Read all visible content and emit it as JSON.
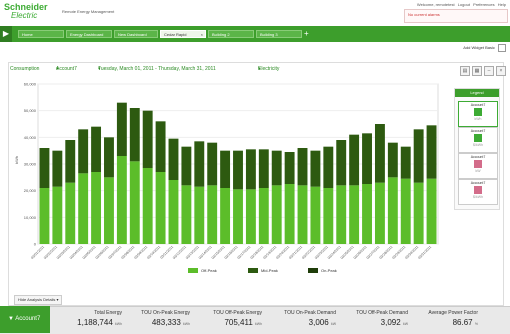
{
  "header": {
    "logo_line1": "Schneider",
    "logo_line2": "Electric",
    "app_name": "Remote Energy Management",
    "links": [
      "Welcome, remotetest",
      "Logout",
      "Preferences",
      "Help"
    ],
    "alert": "No current alarms"
  },
  "tabs": [
    {
      "label": "Home",
      "active": false
    },
    {
      "label": "Energy Dashboard",
      "active": false
    },
    {
      "label": "New Dashboard",
      "active": false
    },
    {
      "label": "Cedar Rapid",
      "active": true
    },
    {
      "label": "Building 2",
      "active": false
    },
    {
      "label": "Building 3",
      "active": false
    }
  ],
  "toolbar": {
    "add_widget": "Add Widget",
    "basic": "Basic"
  },
  "filters": {
    "metric": "Consumption",
    "account": "Account7",
    "date_range": "Tuesday, March 01, 2011 - Thursday, March 31, 2011",
    "type": "Electricity"
  },
  "legend": {
    "title": "Legend",
    "cards": [
      {
        "name": "Account7",
        "sub": "kWh",
        "color": "#3dab34"
      },
      {
        "name": "Account7",
        "sub": "$/kWh",
        "color": "#3dab34"
      },
      {
        "name": "Account7",
        "sub": "kW",
        "color": "#d36c8a"
      },
      {
        "name": "Account7",
        "sub": "$/kWh",
        "color": "#d36c8a"
      }
    ]
  },
  "analysis_details": "Hide Analysis Details",
  "summary": {
    "account": "Account7",
    "metrics": [
      {
        "title": "Total Energy",
        "value": "1,188,744",
        "unit": "kWh"
      },
      {
        "title": "TOU On-Peak Energy",
        "value": "483,333",
        "unit": "kWh"
      },
      {
        "title": "TOU Off-Peak Energy",
        "value": "705,411",
        "unit": "kWh"
      },
      {
        "title": "TOU On-Peak Demand",
        "value": "3,006",
        "unit": "kW"
      },
      {
        "title": "TOU Off-Peak Demand",
        "value": "3,092",
        "unit": "kW"
      },
      {
        "title": "Average Power Factor",
        "value": "86.67",
        "unit": "%"
      }
    ]
  },
  "colors": {
    "brand": "#3dab34",
    "tab_green": "#3d9e2c",
    "bar_light": "#5cbd2a",
    "bar_dark": "#2d5a10"
  },
  "chart_data": {
    "type": "bar",
    "stacked": true,
    "ylabel": "kWh",
    "ylim": [
      0,
      60000
    ],
    "yticks": [
      "0",
      "10,000",
      "20,000",
      "30,000",
      "40,000",
      "50,000",
      "60,000"
    ],
    "categories": [
      "03/01/2011",
      "03/02/2011",
      "03/03/2011",
      "03/04/2011",
      "03/05/2011",
      "03/06/2011",
      "03/07/2011",
      "03/08/2011",
      "03/09/2011",
      "03/10/2011",
      "03/11/2011",
      "03/12/2011",
      "03/13/2011",
      "03/14/2011",
      "03/15/2011",
      "03/16/2011",
      "03/17/2011",
      "03/18/2011",
      "03/19/2011",
      "03/20/2011",
      "03/21/2011",
      "03/22/2011",
      "03/23/2011",
      "03/24/2011",
      "03/25/2011",
      "03/26/2011",
      "03/27/2011",
      "03/28/2011",
      "03/29/2011",
      "03/30/2011",
      "03/31/2011"
    ],
    "series": [
      {
        "name": "Off-Peak",
        "color": "#5cbd2a",
        "values": [
          21000,
          21500,
          23000,
          26500,
          27000,
          25000,
          33000,
          31000,
          28500,
          27000,
          24000,
          22000,
          21500,
          22000,
          21000,
          20500,
          20500,
          21000,
          22000,
          22500,
          22000,
          21500,
          21000,
          22000,
          22000,
          22500,
          23000,
          25000,
          24500,
          23000,
          24500
        ]
      },
      {
        "name": "Mid-Peak",
        "color": "#2d5a10",
        "values": [
          15000,
          13500,
          16000,
          16500,
          17000,
          15000,
          20000,
          20000,
          21500,
          19000,
          15500,
          14500,
          17000,
          16000,
          14000,
          14500,
          15000,
          14500,
          13000,
          12000,
          14000,
          13500,
          15500,
          17000,
          19000,
          19000,
          22000,
          13000,
          12000,
          20000,
          20000
        ]
      },
      {
        "name": "On-Peak",
        "color": "#1f3d0a",
        "values": [
          0,
          0,
          0,
          0,
          0,
          0,
          0,
          0,
          0,
          0,
          0,
          0,
          0,
          0,
          0,
          0,
          0,
          0,
          0,
          0,
          0,
          0,
          0,
          0,
          0,
          0,
          0,
          0,
          0,
          0,
          0
        ]
      }
    ]
  }
}
